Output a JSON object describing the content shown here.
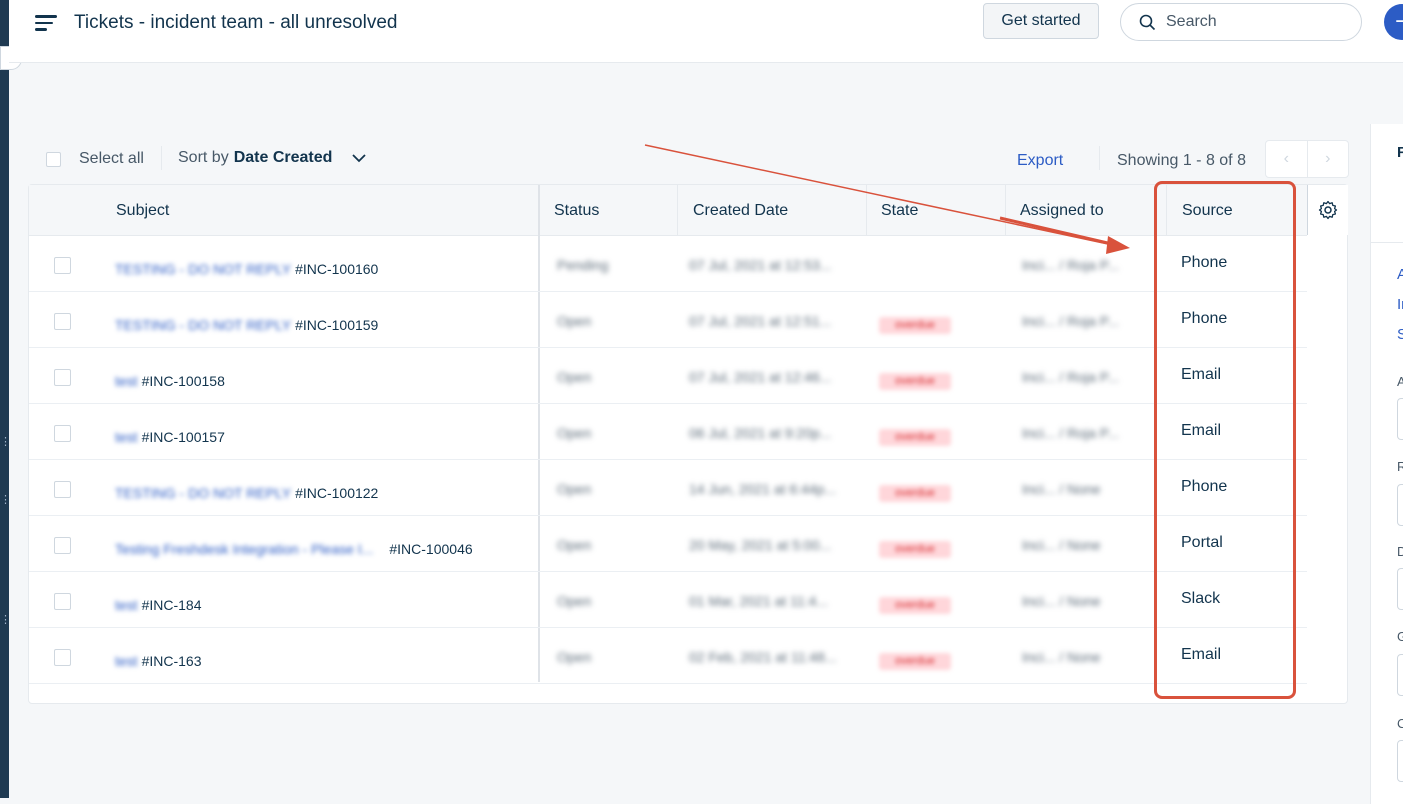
{
  "header": {
    "title": "Tickets - incident team - all unresolved",
    "get_started_label": "Get started",
    "search_placeholder": "Search"
  },
  "toolbar": {
    "select_all_label": "Select all",
    "sort_prefix": "Sort by",
    "sort_value": "Date Created",
    "export_label": "Export",
    "showing_text": "Showing 1 - 8 of 8"
  },
  "table": {
    "columns": [
      "Subject",
      "Status",
      "Created Date",
      "State",
      "Assigned to",
      "Source"
    ],
    "rows": [
      {
        "subject": "TESTING - DO NOT REPLY",
        "id": "#INC-100160",
        "status": "Pending",
        "created": "07 Jul, 2021 at 12:53...",
        "state": "",
        "assigned": "Inci... / Roja P...",
        "source": "Phone"
      },
      {
        "subject": "TESTING - DO NOT REPLY",
        "id": "#INC-100159",
        "status": "Open",
        "created": "07 Jul, 2021 at 12:51...",
        "state": "overdue",
        "assigned": "Inci... / Roja P...",
        "source": "Phone"
      },
      {
        "subject": "test",
        "id": "#INC-100158",
        "status": "Open",
        "created": "07 Jul, 2021 at 12:46...",
        "state": "overdue",
        "assigned": "Inci... / Roja P...",
        "source": "Email"
      },
      {
        "subject": "test",
        "id": "#INC-100157",
        "status": "Open",
        "created": "06 Jul, 2021 at 9:20p...",
        "state": "overdue",
        "assigned": "Inci... / Roja P...",
        "source": "Email"
      },
      {
        "subject": "TESTING - DO NOT REPLY",
        "id": "#INC-100122",
        "status": "Open",
        "created": "14 Jun, 2021 at 6:44p...",
        "state": "overdue",
        "assigned": "Inci... / None",
        "source": "Phone"
      },
      {
        "subject": "Testing Freshdesk Integration - Please I...",
        "id": "#INC-100046",
        "status": "Open",
        "created": "20 May, 2021 at 5:00...",
        "state": "overdue",
        "assigned": "Inci... / None",
        "source": "Portal"
      },
      {
        "subject": "test",
        "id": "#INC-184",
        "status": "Open",
        "created": "01 Mar, 2021 at 11:4...",
        "state": "overdue",
        "assigned": "Inci... / None",
        "source": "Slack"
      },
      {
        "subject": "test",
        "id": "#INC-163",
        "status": "Open",
        "created": "02 Feb, 2021 at 11:48...",
        "state": "overdue",
        "assigned": "Inci... / None",
        "source": "Email"
      }
    ]
  },
  "right_panel": {
    "letters": [
      "F",
      "A",
      "In",
      "S",
      "A",
      "R",
      "D",
      "G",
      "C"
    ]
  },
  "colors": {
    "accent": "#2c5cc5",
    "annotation": "#d9523c",
    "rail": "#1f3a52"
  }
}
